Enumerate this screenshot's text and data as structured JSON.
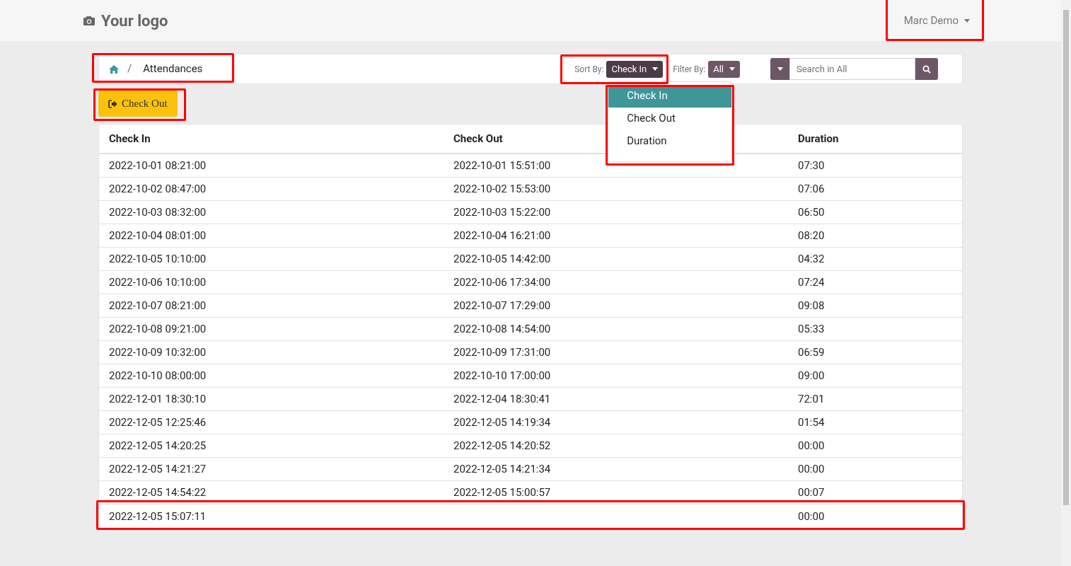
{
  "header": {
    "logo": "Your logo",
    "user": {
      "name": "Marc Demo",
      "highlighted": true
    }
  },
  "breadcrumb": {
    "current": "Attendances",
    "separator": "/",
    "highlighted": true
  },
  "sort": {
    "label": "Sort By:",
    "value": "Check In",
    "highlighted": true,
    "menu": {
      "highlighted": true,
      "items": [
        {
          "label": "Check In",
          "selected": true
        },
        {
          "label": "Check Out",
          "selected": false
        },
        {
          "label": "Duration",
          "selected": false
        }
      ]
    }
  },
  "filter": {
    "label": "Filter By:",
    "value": "All"
  },
  "search": {
    "placeholder": "Search in All"
  },
  "action_button": {
    "label": "Check Out",
    "highlighted": true
  },
  "table": {
    "columns": [
      "Check In",
      "Check Out",
      "Duration"
    ],
    "rows": [
      {
        "cells": [
          "2022-10-01 08:21:00",
          "2022-10-01 15:51:00",
          "07:30"
        ],
        "highlighted": false
      },
      {
        "cells": [
          "2022-10-02 08:47:00",
          "2022-10-02 15:53:00",
          "07:06"
        ],
        "highlighted": false
      },
      {
        "cells": [
          "2022-10-03 08:32:00",
          "2022-10-03 15:22:00",
          "06:50"
        ],
        "highlighted": false
      },
      {
        "cells": [
          "2022-10-04 08:01:00",
          "2022-10-04 16:21:00",
          "08:20"
        ],
        "highlighted": false
      },
      {
        "cells": [
          "2022-10-05 10:10:00",
          "2022-10-05 14:42:00",
          "04:32"
        ],
        "highlighted": false
      },
      {
        "cells": [
          "2022-10-06 10:10:00",
          "2022-10-06 17:34:00",
          "07:24"
        ],
        "highlighted": false
      },
      {
        "cells": [
          "2022-10-07 08:21:00",
          "2022-10-07 17:29:00",
          "09:08"
        ],
        "highlighted": false
      },
      {
        "cells": [
          "2022-10-08 09:21:00",
          "2022-10-08 14:54:00",
          "05:33"
        ],
        "highlighted": false
      },
      {
        "cells": [
          "2022-10-09 10:32:00",
          "2022-10-09 17:31:00",
          "06:59"
        ],
        "highlighted": false
      },
      {
        "cells": [
          "2022-10-10 08:00:00",
          "2022-10-10 17:00:00",
          "09:00"
        ],
        "highlighted": false
      },
      {
        "cells": [
          "2022-12-01 18:30:10",
          "2022-12-04 18:30:41",
          "72:01"
        ],
        "highlighted": false
      },
      {
        "cells": [
          "2022-12-05 12:25:46",
          "2022-12-05 14:19:34",
          "01:54"
        ],
        "highlighted": false
      },
      {
        "cells": [
          "2022-12-05 14:20:25",
          "2022-12-05 14:20:52",
          "00:00"
        ],
        "highlighted": false
      },
      {
        "cells": [
          "2022-12-05 14:21:27",
          "2022-12-05 14:21:34",
          "00:00"
        ],
        "highlighted": false
      },
      {
        "cells": [
          "2022-12-05 14:54:22",
          "2022-12-05 15:00:57",
          "00:07"
        ],
        "highlighted": false
      },
      {
        "cells": [
          "2022-12-05 15:07:11",
          "",
          "00:00"
        ],
        "highlighted": true
      }
    ]
  }
}
